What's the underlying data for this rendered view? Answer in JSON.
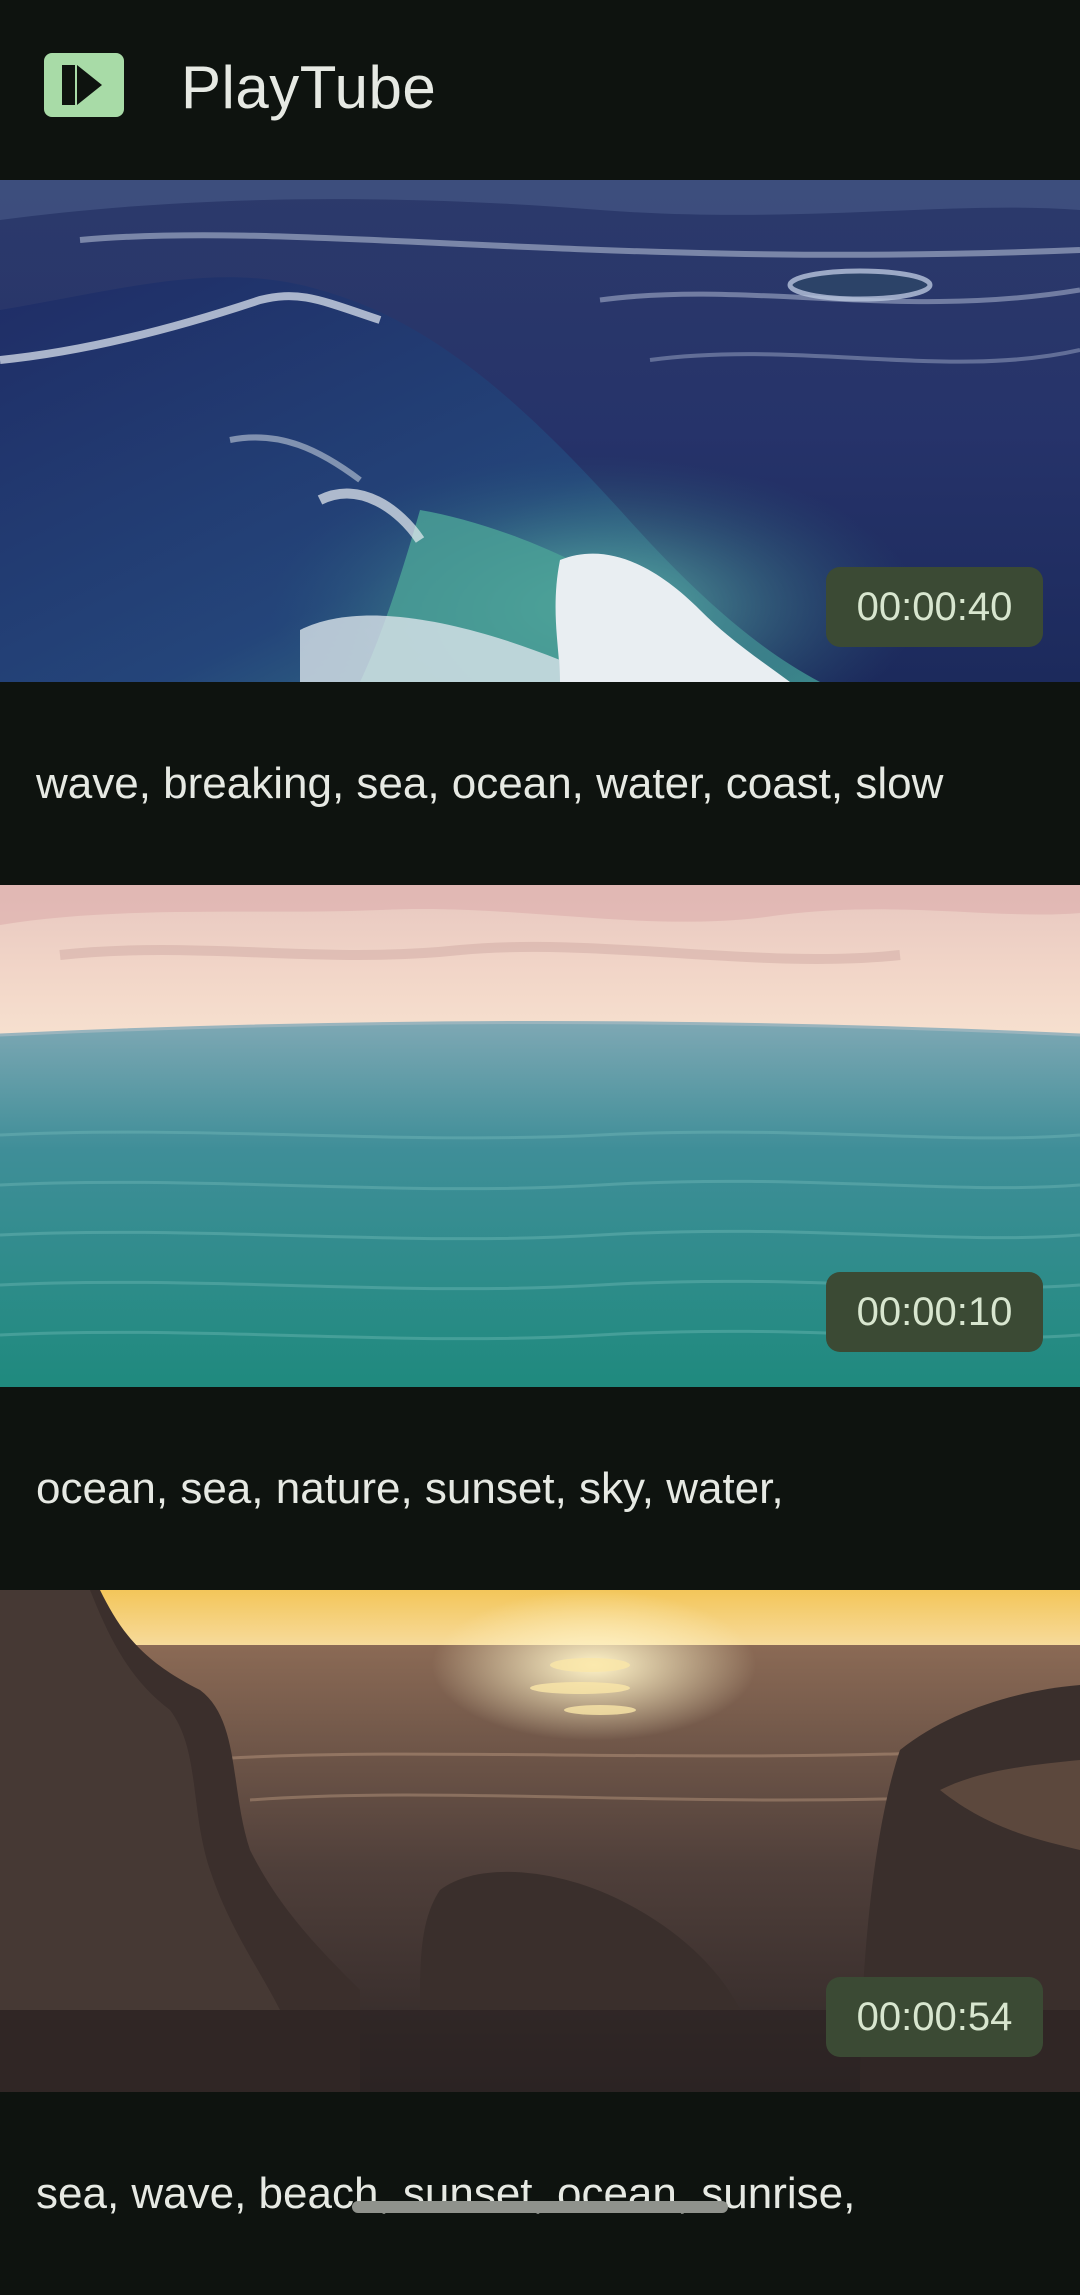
{
  "app": {
    "title": "PlayTube",
    "logo_icon": "play-icon",
    "accent_color": "#a8dba7"
  },
  "videos": [
    {
      "duration": "00:00:40",
      "tags": "wave, breaking, sea, ocean, water, coast, slow"
    },
    {
      "duration": "00:00:10",
      "tags": "ocean, sea, nature, sunset, sky, water,"
    },
    {
      "duration": "00:00:54",
      "tags": "sea, wave, beach, sunset, ocean, sunrise,"
    }
  ]
}
